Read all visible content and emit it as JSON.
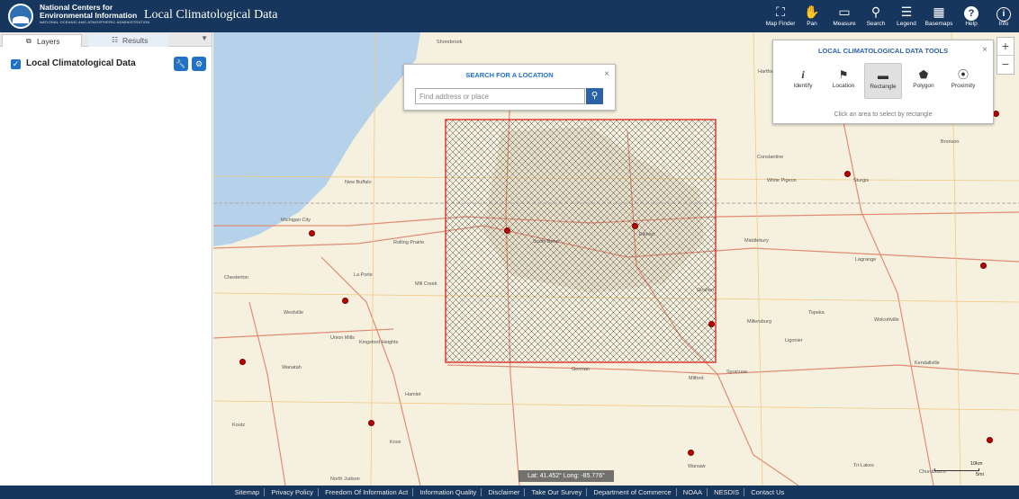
{
  "header": {
    "org_line1": "National Centers for",
    "org_line2": "Environmental Information",
    "org_sub": "NATIONAL OCEANIC AND ATMOSPHERIC ADMINISTRATION",
    "app_title": "Local Climatological Data",
    "buttons": [
      {
        "label": "Map Finder",
        "icon": "map-finder-icon"
      },
      {
        "label": "Pan",
        "icon": "pan-hand-icon"
      },
      {
        "label": "Measure",
        "icon": "ruler-icon"
      },
      {
        "label": "Search",
        "icon": "search-icon"
      },
      {
        "label": "Legend",
        "icon": "legend-list-icon"
      },
      {
        "label": "Basemaps",
        "icon": "basemaps-grid-icon"
      },
      {
        "label": "Help",
        "icon": "help-icon"
      },
      {
        "label": "Info",
        "icon": "info-icon"
      }
    ]
  },
  "sidebar": {
    "tabs": [
      {
        "label": "Layers",
        "active": true
      },
      {
        "label": "Results",
        "active": false
      }
    ],
    "layer": {
      "label": "Local Climatological Data",
      "checked": true
    }
  },
  "search": {
    "title": "SEARCH FOR A LOCATION",
    "placeholder": "Find address or place",
    "close": "×"
  },
  "tools": {
    "title": "LOCAL CLIMATOLOGICAL DATA TOOLS",
    "close": "×",
    "items": [
      {
        "label": "Identify",
        "icon": "info-italic-icon"
      },
      {
        "label": "Location",
        "icon": "flag-icon"
      },
      {
        "label": "Rectangle",
        "icon": "rectangle-icon",
        "selected": true
      },
      {
        "label": "Polygon",
        "icon": "polygon-icon"
      },
      {
        "label": "Proximity",
        "icon": "proximity-icon"
      }
    ],
    "hint": "Click an area to select by rectangle"
  },
  "zoom": {
    "in": "+",
    "out": "−"
  },
  "coords": "Lat: 41.452°  Long: -85.776°",
  "scale": {
    "top": "10km",
    "bottom": "5mi"
  },
  "map_labels": [
    "Shorebrook",
    "Hartford",
    "Benton Harbor",
    "Dowagiac",
    "Cassopolis",
    "Niles",
    "Buchanan",
    "Bridgman",
    "New Buffalo",
    "Michigan City",
    "Constantine",
    "White Pigeon",
    "Sturgis",
    "Bronson",
    "Colon",
    "Elkhart",
    "South Bend",
    "Mishawaka",
    "Goshen",
    "Middlebury",
    "Lagrange",
    "Rolling Prairie",
    "La Porte",
    "Chesterton",
    "Mill Creek",
    "Westville",
    "Union Mills",
    "Kingsford Heights",
    "Millersburg",
    "Topeka",
    "Wolcottville",
    "Ligonier",
    "Kendallville",
    "Syracuse",
    "Milford",
    "Warsaw",
    "Nappanee",
    "Bremen",
    "Plymouth",
    "Knox",
    "Hamlet",
    "Wanatah",
    "Koutz",
    "North Judson",
    "Tri-Lakes",
    "Churubusco",
    "Albion",
    "Avilla",
    "Waterloo",
    "Orland",
    "Howe",
    "Angola",
    "Lakeville",
    "Walkerton",
    "North Liberty",
    "Indiana Dunes",
    "Granger",
    "Osceola",
    "Wakarusa",
    "German",
    "Bristol",
    "Edwardsburg",
    "Vandalia",
    "Centreville",
    "Mendon",
    "Three Rivers",
    "Coloma"
  ],
  "footer": [
    "Sitemap",
    "Privacy Policy",
    "Freedom Of Information Act",
    "Information Quality",
    "Disclaimer",
    "Take Our Survey",
    "Department of Commerce",
    "NOAA",
    "NESDIS",
    "Contact Us"
  ],
  "colors": {
    "header_bg": "#17365d",
    "accent": "#2271c8",
    "selection_red": "#e02020",
    "station": "#b00000"
  }
}
